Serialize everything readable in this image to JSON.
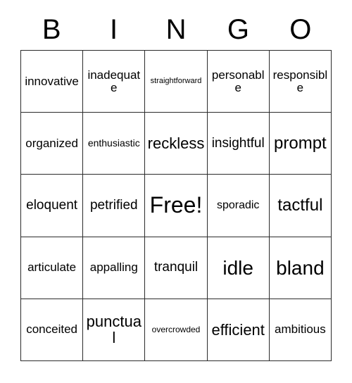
{
  "card": {
    "title": "BINGO",
    "header_letters": [
      "B",
      "I",
      "N",
      "G",
      "O"
    ],
    "free_space": "Free!",
    "colors": {
      "background": "#ffffff",
      "border": "#2b2b2b",
      "text": "#000000"
    },
    "grid": {
      "columns": 5,
      "rows": 5,
      "cells": [
        [
          {
            "text": "innovative",
            "size": "fs-ml"
          },
          {
            "text": "inadequate",
            "size": "fs-ml"
          },
          {
            "text": "straightforward",
            "size": "fs-xs"
          },
          {
            "text": "personable",
            "size": "fs-ml"
          },
          {
            "text": "responsible",
            "size": "fs-ml"
          }
        ],
        [
          {
            "text": "organized",
            "size": "fs-ml"
          },
          {
            "text": "enthusiastic",
            "size": "fs-sm"
          },
          {
            "text": "reckless",
            "size": "fs-xl"
          },
          {
            "text": "insightful",
            "size": "fs-l"
          },
          {
            "text": "prompt",
            "size": "fs-xxl"
          }
        ],
        [
          {
            "text": "eloquent",
            "size": "fs-l"
          },
          {
            "text": "petrified",
            "size": "fs-l"
          },
          {
            "text": "Free!",
            "size": "fs-free"
          },
          {
            "text": "sporadic",
            "size": "fs-m"
          },
          {
            "text": "tactful",
            "size": "fs-xxl"
          }
        ],
        [
          {
            "text": "articulate",
            "size": "fs-ml"
          },
          {
            "text": "appalling",
            "size": "fs-ml"
          },
          {
            "text": "tranquil",
            "size": "fs-l"
          },
          {
            "text": "idle",
            "size": "fs-huge"
          },
          {
            "text": "bland",
            "size": "fs-huge"
          }
        ],
        [
          {
            "text": "conceited",
            "size": "fs-ml"
          },
          {
            "text": "punctual",
            "size": "fs-xl"
          },
          {
            "text": "overcrowded",
            "size": "fs-s"
          },
          {
            "text": "efficient",
            "size": "fs-xl"
          },
          {
            "text": "ambitious",
            "size": "fs-ml"
          }
        ]
      ]
    }
  }
}
